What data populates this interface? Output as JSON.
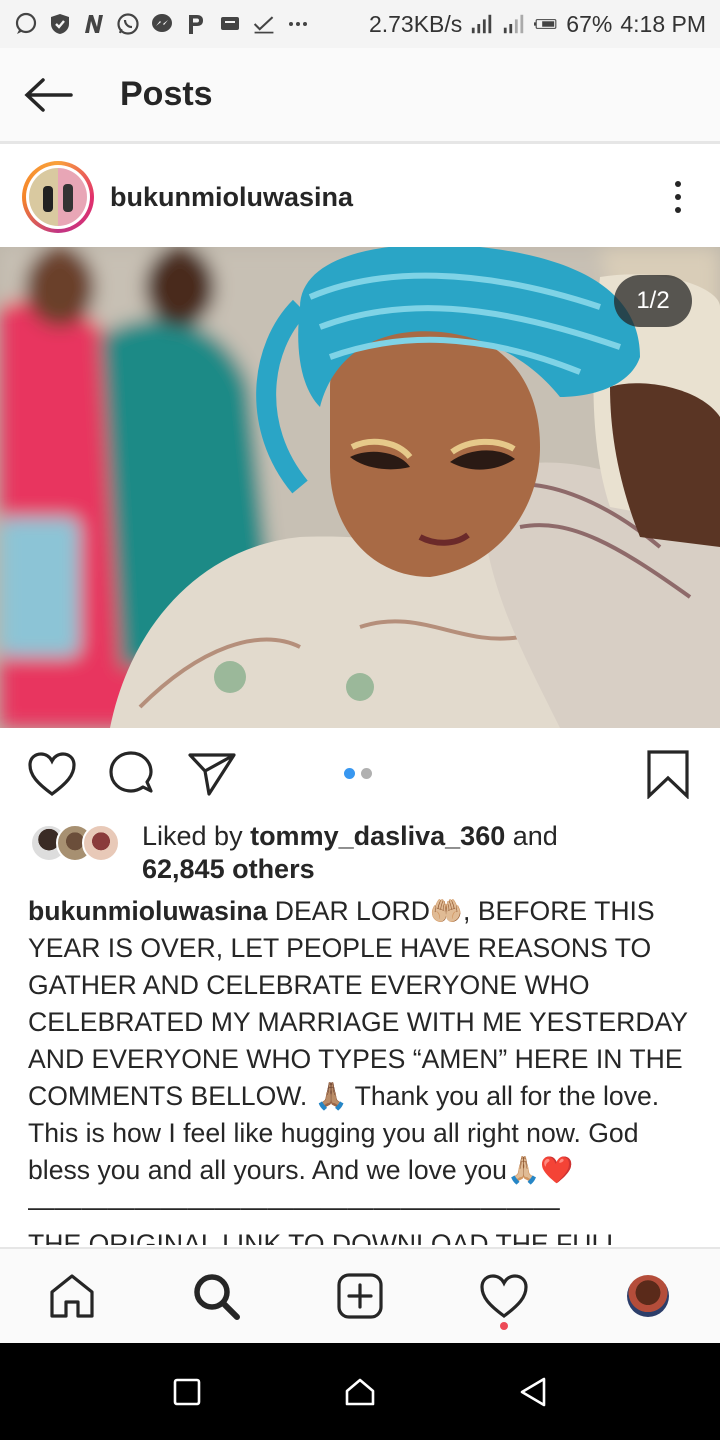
{
  "status_bar": {
    "speed": "2.73KB/s",
    "battery": "67%",
    "time": "4:18 PM"
  },
  "header": {
    "title": "Posts"
  },
  "post": {
    "username": "bukunmioluwasina",
    "photo_counter": "1/2",
    "carousel": {
      "count": 2,
      "active": 1
    },
    "liked_by_prefix": "Liked by ",
    "liked_by_user": "tommy_dasliva_360",
    "liked_by_and": " and",
    "others_count": "62,845 others",
    "caption_username": "bukunmioluwasina",
    "caption_text": " DEAR LORD🤲🏼, BEFORE THIS YEAR IS OVER, LET PEOPLE HAVE REASONS TO GATHER AND CELEBRATE EVERYONE WHO CELEBRATED MY MARRIAGE WITH ME YESTERDAY AND EVERYONE WHO TYPES “AMEN” HERE IN THE COMMENTS BELLOW. 🙏🏽 Thank you all for the love. This is how I feel like hugging you all right now. God bless you and all yours. And we love you🙏🏼❤️",
    "caption_separator": "————————————————————",
    "caption_more": "THE ORIGINAL LINK TO DOWNLOAD THE FULL"
  },
  "icons": {
    "status_left": [
      "message-icon",
      "shield-icon",
      "n-icon",
      "whatsapp-icon",
      "messenger-icon",
      "p-icon",
      "chat-icon",
      "check-icon",
      "more-icon"
    ],
    "actions": [
      "heart-icon",
      "comment-icon",
      "share-icon",
      "bookmark-icon"
    ],
    "bottom_nav": [
      "home-icon",
      "search-icon",
      "add-post-icon",
      "activity-heart-icon",
      "profile-avatar"
    ]
  },
  "colors": {
    "accent_blue": "#3897f0",
    "notification_red": "#ed4956",
    "heart_red": "#e0243c"
  }
}
